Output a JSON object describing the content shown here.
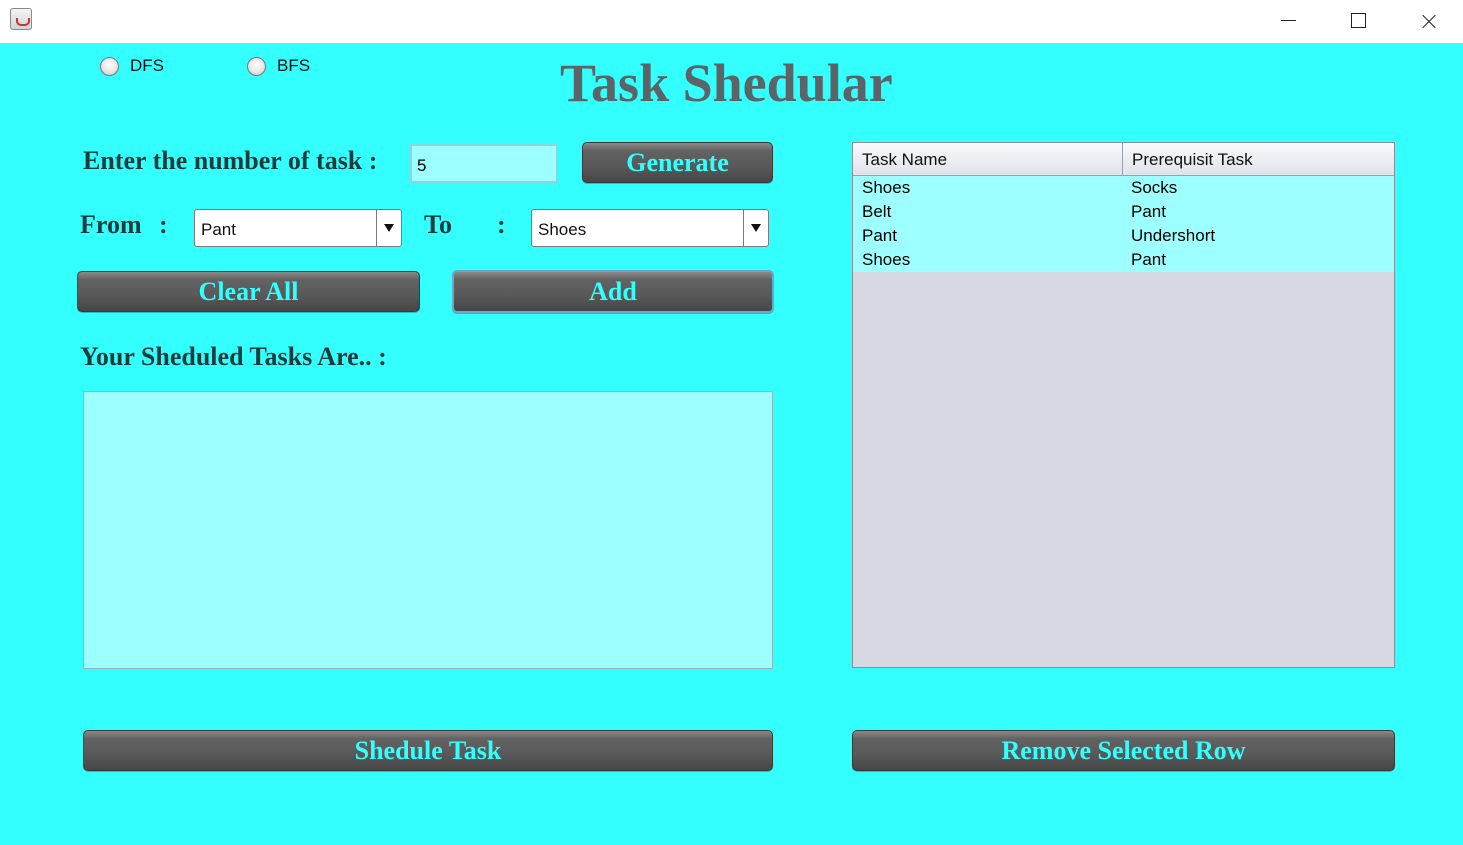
{
  "window": {
    "title_icon": "java-cup-icon",
    "controls": [
      "minimize-icon",
      "maximize-icon",
      "close-icon"
    ]
  },
  "algorithm": {
    "options": [
      {
        "label": "DFS",
        "selected": false
      },
      {
        "label": "BFS",
        "selected": false
      }
    ]
  },
  "header": {
    "title": "Task Shedular"
  },
  "task_count": {
    "label": "Enter the number of task :",
    "value": "5"
  },
  "buttons": {
    "generate": "Generate",
    "clear_all": "Clear All",
    "add": "Add",
    "schedule": "Shedule Task",
    "remove_row": "Remove Selected Row"
  },
  "dependency": {
    "from_label": "From",
    "from_colon": ":",
    "from_value": "Pant",
    "to_label": "To",
    "to_colon": ":",
    "to_value": "Shoes"
  },
  "schedule": {
    "heading": "Your Sheduled Tasks Are.. :",
    "output": ""
  },
  "table": {
    "columns": [
      "Task Name",
      "Prerequisit Task"
    ],
    "rows": [
      [
        "Shoes",
        "Socks"
      ],
      [
        "Belt",
        "Pant"
      ],
      [
        "Pant",
        "Undershort"
      ],
      [
        "Shoes",
        "Pant"
      ]
    ]
  },
  "colors": {
    "background": "#33FFFF",
    "field": "#9EFFFF",
    "button": "#5A5A5A",
    "button_text": "#33FFFF",
    "title": "#5C6467",
    "table_empty": "#D6D9E1"
  }
}
